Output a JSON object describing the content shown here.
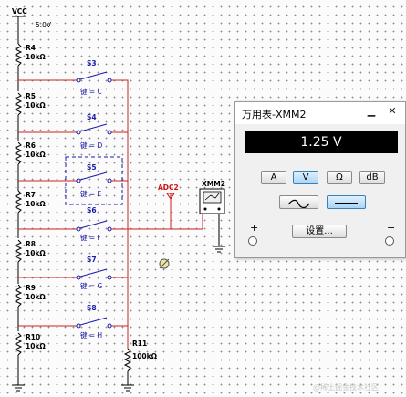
{
  "schematic": {
    "vcc_label": "VCC",
    "vcc_value": "5.0V",
    "resistors": [
      {
        "name": "R4",
        "value": "10kΩ"
      },
      {
        "name": "R5",
        "value": "10kΩ"
      },
      {
        "name": "R6",
        "value": "10kΩ"
      },
      {
        "name": "R7",
        "value": "10kΩ"
      },
      {
        "name": "R8",
        "value": "10kΩ"
      },
      {
        "name": "R9",
        "value": "10kΩ"
      },
      {
        "name": "R10",
        "value": "10kΩ"
      },
      {
        "name": "R11",
        "value": "100kΩ"
      }
    ],
    "switches": [
      {
        "name": "S3",
        "key": "键 = C"
      },
      {
        "name": "S4",
        "key": "键 = D"
      },
      {
        "name": "S5",
        "key": "键 = E"
      },
      {
        "name": "S6",
        "key": "键 = F"
      },
      {
        "name": "S7",
        "key": "键 = G"
      },
      {
        "name": "S8",
        "key": "键 = H"
      }
    ],
    "probe_label": "ADC2",
    "meter_label": "XMM2",
    "watermark": "@稀土掘金技术社区"
  },
  "multimeter": {
    "title": "万用表-XMM2",
    "reading": "1.25 V",
    "mode_buttons": [
      "A",
      "V",
      "Ω",
      "dB"
    ],
    "active_mode": "V",
    "waveform_buttons": [
      "ac-wave-icon",
      "dc-line-icon"
    ],
    "active_waveform": "dc-line-icon",
    "settings_label": "设置...",
    "plus_label": "+",
    "minus_label": "−",
    "window_buttons": [
      "minimize-icon",
      "close-icon"
    ]
  }
}
